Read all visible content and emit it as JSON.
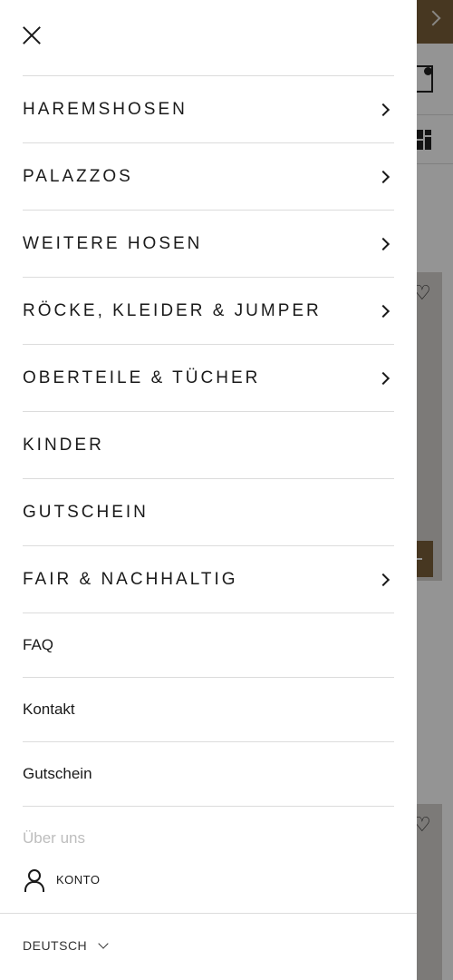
{
  "menu": {
    "main_items": [
      {
        "label": "HAREMSHOSEN",
        "has_submenu": true
      },
      {
        "label": "PALAZZOS",
        "has_submenu": true
      },
      {
        "label": "WEITERE HOSEN",
        "has_submenu": true
      },
      {
        "label": "RÖCKE, KLEIDER & JUMPER",
        "has_submenu": true
      },
      {
        "label": "OBERTEILE & TÜCHER",
        "has_submenu": true
      },
      {
        "label": "KINDER",
        "has_submenu": false
      },
      {
        "label": "GUTSCHEIN",
        "has_submenu": false
      },
      {
        "label": "FAIR & NACHHALTIG",
        "has_submenu": true
      }
    ],
    "secondary_items": [
      {
        "label": "FAQ"
      },
      {
        "label": "Kontakt"
      },
      {
        "label": "Gutschein"
      },
      {
        "label": "Über uns"
      }
    ]
  },
  "account": {
    "label": "KONTO",
    "icon": "user-icon"
  },
  "language": {
    "label": "DEUTSCH",
    "icon": "chevron-down-icon"
  },
  "colors": {
    "accent": "#7a5f3a",
    "text": "#1a1a1a",
    "divider": "#dcdcdc",
    "overlay": "rgba(0,0,0,0.42)"
  }
}
